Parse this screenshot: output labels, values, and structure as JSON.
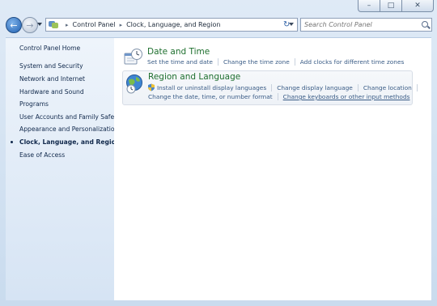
{
  "address": {
    "crumbs": [
      "Control Panel",
      "Clock, Language, and Region"
    ]
  },
  "search": {
    "placeholder": "Search Control Panel"
  },
  "sidebar": {
    "home": "Control Panel Home",
    "items": [
      {
        "label": "System and Security"
      },
      {
        "label": "Network and Internet"
      },
      {
        "label": "Hardware and Sound"
      },
      {
        "label": "Programs"
      },
      {
        "label": "User Accounts and Family Safety"
      },
      {
        "label": "Appearance and Personalization"
      },
      {
        "label": "Clock, Language, and Region",
        "active": true
      },
      {
        "label": "Ease of Access"
      }
    ]
  },
  "categories": [
    {
      "title": "Date and Time",
      "icon": "clock-calendar-icon",
      "links": [
        "Set the time and date",
        "Change the time zone",
        "Add clocks for different time zones"
      ]
    },
    {
      "title": "Region and Language",
      "icon": "globe-clock-icon",
      "links_row1": [
        "Install or uninstall display languages",
        "Change display language",
        "Change location"
      ],
      "links_row2": [
        "Change the date, time, or number format",
        "Change keyboards or other input methods"
      ]
    }
  ],
  "colors": {
    "category_title": "#1e6f2e",
    "link": "#3a5c86",
    "sidebar_text": "#10284b"
  }
}
